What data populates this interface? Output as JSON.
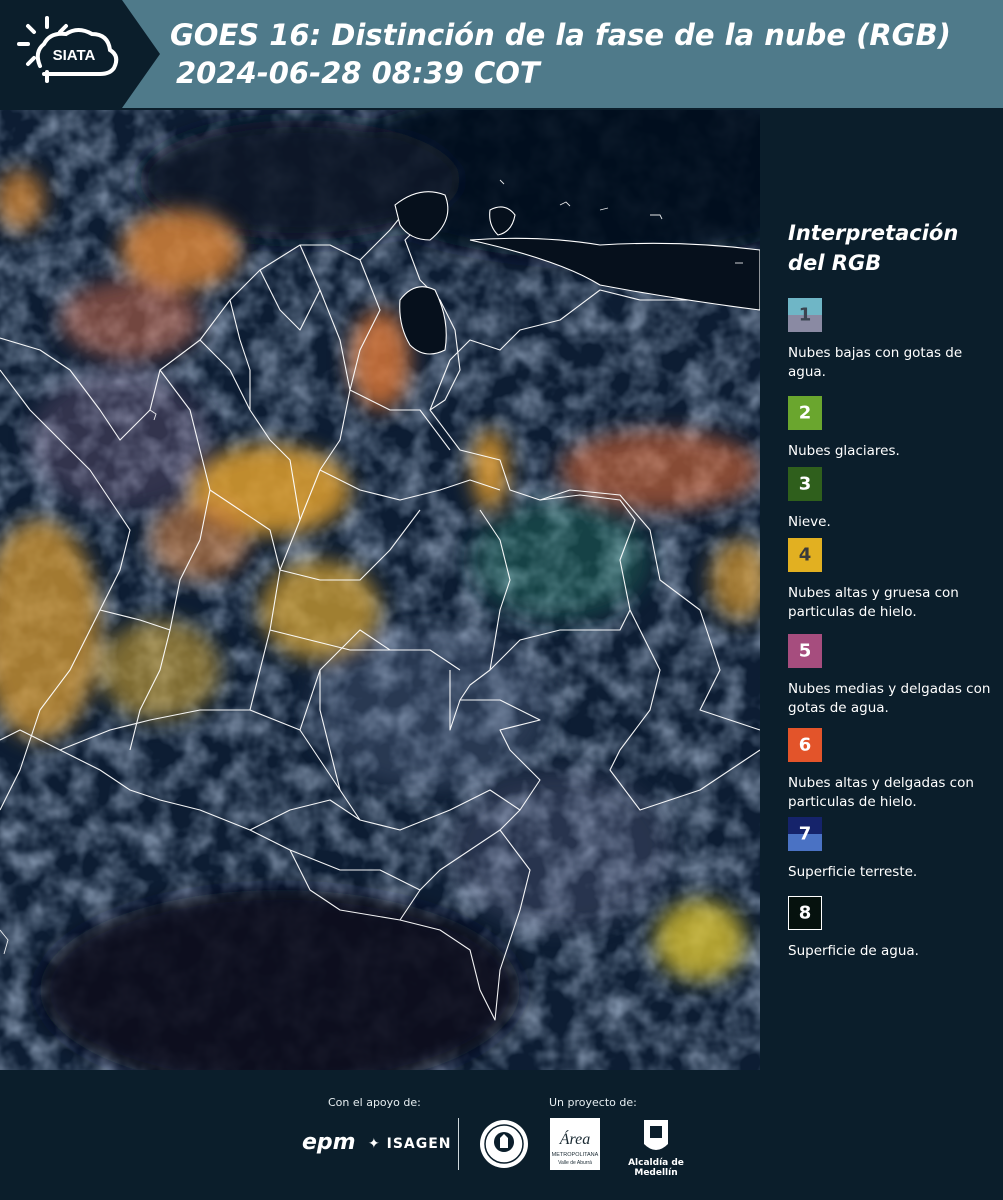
{
  "header": {
    "logo_text": "SIATA",
    "title_line1": "GOES 16: Distinción de la fase de la nube (RGB)",
    "title_line2": "2024-06-28 08:39 COT"
  },
  "legend": {
    "title": "Interpretación del RGB",
    "items": [
      {
        "number": "1",
        "description": "Nubes bajas con gotas de agua.",
        "color_top": "#6fb6c6",
        "color_bottom": "#8a8aa3",
        "number_color": "#3a4450"
      },
      {
        "number": "2",
        "description": "Nubes glaciares.",
        "color": "#6aa62e",
        "number_color": "#ffffff"
      },
      {
        "number": "3",
        "description": "Nieve.",
        "color": "#2f5f1c",
        "number_color": "#ffffff"
      },
      {
        "number": "4",
        "description": "Nubes altas y gruesa con particulas de hielo.",
        "color": "#e2b021",
        "number_color": "#3a3a3a"
      },
      {
        "number": "5",
        "description": "Nubes medias y delgadas con gotas de agua.",
        "color": "#a64d7e",
        "number_color": "#ffffff"
      },
      {
        "number": "6",
        "description": "Nubes altas y delgadas con particulas de hielo.",
        "color": "#e3542a",
        "number_color": "#ffffff"
      },
      {
        "number": "7",
        "description": "Superficie terreste.",
        "color_top": "#15236b",
        "color_bottom": "#4a72c4",
        "number_color": "#ffffff"
      },
      {
        "number": "8",
        "description": "Superficie de agua.",
        "color": "#06120e",
        "number_color": "#ffffff"
      }
    ]
  },
  "footer": {
    "support_label": "Con el apoyo de:",
    "project_label": "Un proyecto de:",
    "sponsor1": "epm",
    "sponsor2": "ISAGEN",
    "partner_area_line1": "Área",
    "partner_area_line2": "METROPOLITANA",
    "partner_area_line3": "Valle de Aburrá",
    "partner_alcaldia": "Alcaldía de Medellín"
  }
}
